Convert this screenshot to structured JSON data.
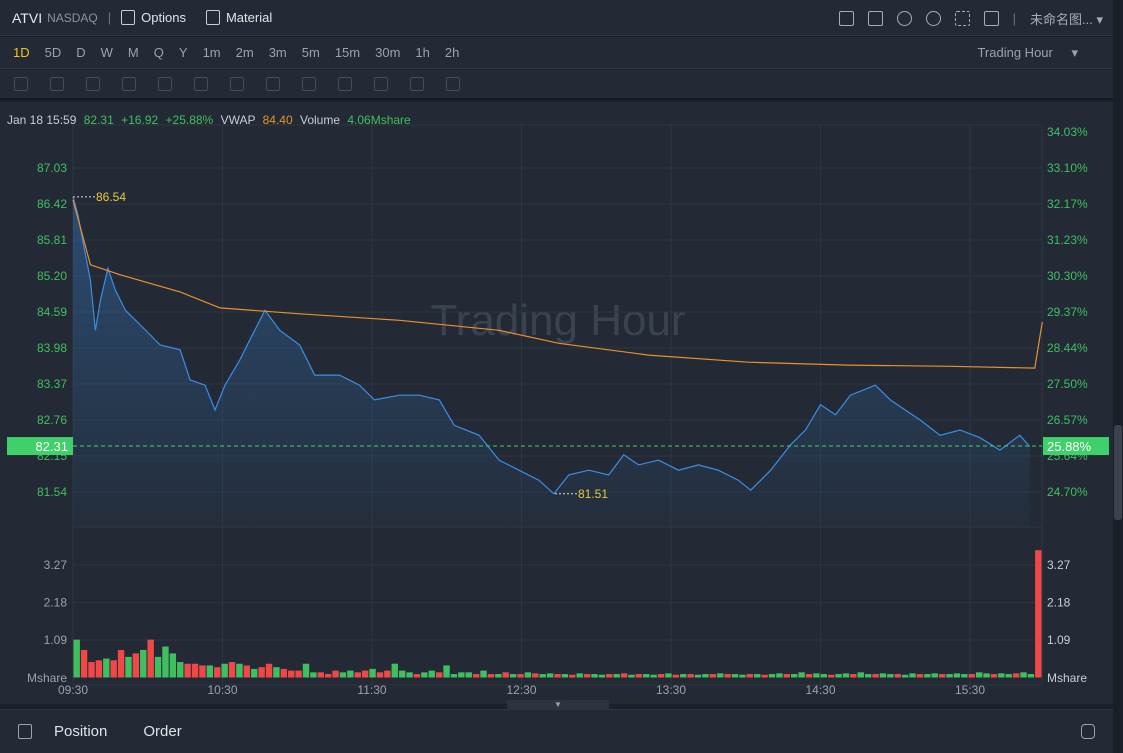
{
  "header": {
    "symbol": "ATVI",
    "exchange": "NASDAQ",
    "options": "Options",
    "material": "Material",
    "layout_name": "未命名图...",
    "icons": [
      "indicator-icon",
      "draw-icon",
      "undo-icon",
      "settings-icon",
      "fullscreen-icon",
      "layout-grid-icon"
    ]
  },
  "periods": [
    "1D",
    "5D",
    "D",
    "W",
    "M",
    "Q",
    "Y",
    "1m",
    "2m",
    "3m",
    "5m",
    "15m",
    "30m",
    "1h",
    "2h"
  ],
  "active_period": "1D",
  "session": "Trading Hour",
  "info": {
    "time": "Jan 18 15:59",
    "price": "82.31",
    "change": "+16.92",
    "pct": "+25.88%",
    "vwap_label": "VWAP",
    "vwap": "84.40",
    "volume_label": "Volume",
    "volume": "4.06Mshare"
  },
  "watermark": "Trading Hour",
  "colors": {
    "up": "#3fbf5f",
    "down": "#f04848",
    "price_line": "#3a8ee6",
    "vwap": "#e8902c",
    "label": "#e8c93a"
  },
  "chart_data": {
    "type": "line",
    "x_ticks": [
      "09:30",
      "10:30",
      "11:30",
      "12:30",
      "13:30",
      "14:30",
      "15:30"
    ],
    "y_ticks": [
      "87.03",
      "86.42",
      "85.81",
      "85.20",
      "84.59",
      "83.98",
      "83.37",
      "82.76",
      "82.15",
      "81.54"
    ],
    "pct_ticks": [
      "34.03%",
      "33.10%",
      "32.17%",
      "31.23%",
      "30.30%",
      "29.37%",
      "28.44%",
      "27.50%",
      "26.57%",
      "25.64%",
      "24.70%"
    ],
    "current_price": "82.31",
    "current_pct": "25.88%",
    "high_label": "86.54",
    "low_label": "81.51",
    "price": [
      [
        0,
        86.54
      ],
      [
        2,
        86.23
      ],
      [
        5,
        85.56
      ],
      [
        7,
        85.13
      ],
      [
        9,
        84.28
      ],
      [
        11,
        84.79
      ],
      [
        14,
        85.33
      ],
      [
        17,
        84.96
      ],
      [
        21,
        84.62
      ],
      [
        27,
        84.37
      ],
      [
        35,
        84.03
      ],
      [
        43,
        83.95
      ],
      [
        47,
        83.44
      ],
      [
        53,
        83.35
      ],
      [
        57,
        82.93
      ],
      [
        61,
        83.35
      ],
      [
        67,
        83.78
      ],
      [
        71,
        84.12
      ],
      [
        77,
        84.62
      ],
      [
        83,
        84.28
      ],
      [
        91,
        84.03
      ],
      [
        97,
        83.52
      ],
      [
        107,
        83.52
      ],
      [
        115,
        83.35
      ],
      [
        121,
        83.1
      ],
      [
        131,
        83.18
      ],
      [
        139,
        83.18
      ],
      [
        147,
        83.1
      ],
      [
        153,
        82.67
      ],
      [
        163,
        82.5
      ],
      [
        171,
        82.08
      ],
      [
        179,
        81.91
      ],
      [
        187,
        81.74
      ],
      [
        193,
        81.51
      ],
      [
        199,
        81.83
      ],
      [
        207,
        81.91
      ],
      [
        215,
        81.83
      ],
      [
        221,
        82.17
      ],
      [
        227,
        82.0
      ],
      [
        235,
        82.08
      ],
      [
        243,
        81.91
      ],
      [
        251,
        82.0
      ],
      [
        259,
        81.91
      ],
      [
        267,
        81.74
      ],
      [
        272,
        81.57
      ],
      [
        280,
        81.91
      ],
      [
        288,
        82.34
      ],
      [
        294,
        82.59
      ],
      [
        300,
        83.02
      ],
      [
        306,
        82.85
      ],
      [
        312,
        83.18
      ],
      [
        322,
        83.35
      ],
      [
        328,
        83.1
      ],
      [
        334,
        82.93
      ],
      [
        340,
        82.76
      ],
      [
        348,
        82.5
      ],
      [
        356,
        82.59
      ],
      [
        364,
        82.46
      ],
      [
        372,
        82.25
      ],
      [
        380,
        82.5
      ],
      [
        384,
        82.31
      ]
    ],
    "vwap": [
      [
        0,
        86.49
      ],
      [
        7,
        85.39
      ],
      [
        19,
        85.22
      ],
      [
        43,
        84.93
      ],
      [
        59,
        84.66
      ],
      [
        91,
        84.56
      ],
      [
        131,
        84.45
      ],
      [
        171,
        84.28
      ],
      [
        195,
        84.06
      ],
      [
        231,
        83.86
      ],
      [
        271,
        83.74
      ],
      [
        311,
        83.69
      ],
      [
        352,
        83.67
      ],
      [
        386,
        83.64
      ],
      [
        389,
        84.42
      ]
    ],
    "volume_ticks": [
      "3.27",
      "2.18",
      "1.09"
    ],
    "volume_unit": "Mshare",
    "volume": [
      1.1,
      -0.8,
      -0.45,
      -0.5,
      0.55,
      -0.5,
      -0.8,
      0.6,
      -0.7,
      0.8,
      -1.1,
      0.6,
      0.9,
      0.7,
      0.45,
      -0.4,
      -0.4,
      -0.35,
      0.35,
      -0.3,
      0.4,
      -0.45,
      0.4,
      -0.35,
      0.25,
      -0.3,
      -0.4,
      0.3,
      -0.25,
      -0.2,
      -0.2,
      0.4,
      0.15,
      -0.15,
      -0.1,
      -0.2,
      0.15,
      0.2,
      -0.15,
      -0.2,
      0.25,
      -0.15,
      -0.2,
      0.4,
      0.2,
      0.15,
      -0.1,
      0.15,
      0.2,
      -0.15,
      0.35,
      0.1,
      0.15,
      0.15,
      -0.1,
      0.2,
      -0.1,
      0.1,
      -0.15,
      0.1,
      -0.1,
      0.15,
      -0.12,
      0.1,
      0.12,
      -0.1,
      0.1,
      -0.08,
      0.12,
      -0.1,
      0.1,
      0.08,
      -0.1,
      0.1,
      -0.12,
      0.08,
      -0.1,
      0.1,
      0.08,
      -0.1,
      0.12,
      -0.08,
      0.1,
      -0.1,
      0.08,
      0.1,
      -0.1,
      0.12,
      -0.1,
      0.1,
      0.08,
      -0.1,
      0.1,
      -0.08,
      0.1,
      0.12,
      -0.1,
      0.1,
      0.15,
      -0.1,
      0.12,
      0.1,
      -0.08,
      0.1,
      0.12,
      -0.1,
      0.15,
      0.1,
      -0.1,
      0.12,
      0.1,
      -0.1,
      0.08,
      0.12,
      -0.1,
      0.1,
      0.12,
      -0.1,
      0.1,
      0.12,
      0.1,
      -0.1,
      0.15,
      0.12,
      -0.1,
      0.12,
      0.1,
      -0.12,
      0.15,
      0.1,
      -3.7
    ]
  },
  "bottom": {
    "position": "Position",
    "order": "Order"
  }
}
